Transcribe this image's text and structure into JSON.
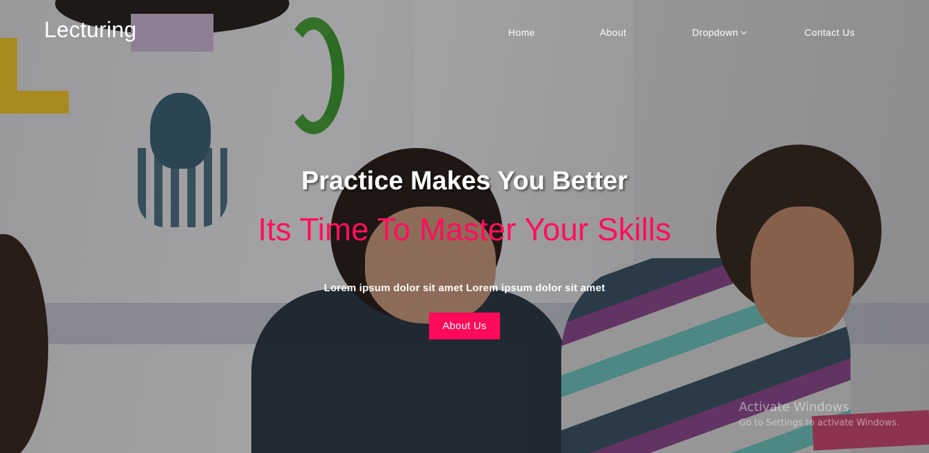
{
  "brand": {
    "name": "Lecturing"
  },
  "nav": {
    "home": "Home",
    "about": "About",
    "dropdown": "Dropdown",
    "contact": "Contact Us"
  },
  "hero": {
    "headline": "Practice Makes You Better",
    "subheadline": "Its Time To Master Your Skills",
    "lead": "Lorem ipsum dolor sit amet Lorem ipsum dolor sit amet",
    "cta_label": "About Us"
  },
  "watermark": {
    "title": "Activate Windows",
    "subtitle": "Go to Settings to activate Windows."
  },
  "colors": {
    "accent": "#ff0a5a",
    "subheadline": "#ff0f5b",
    "text": "#ffffff"
  },
  "icons": {
    "dropdown_chevron": "chevron-down-icon"
  }
}
